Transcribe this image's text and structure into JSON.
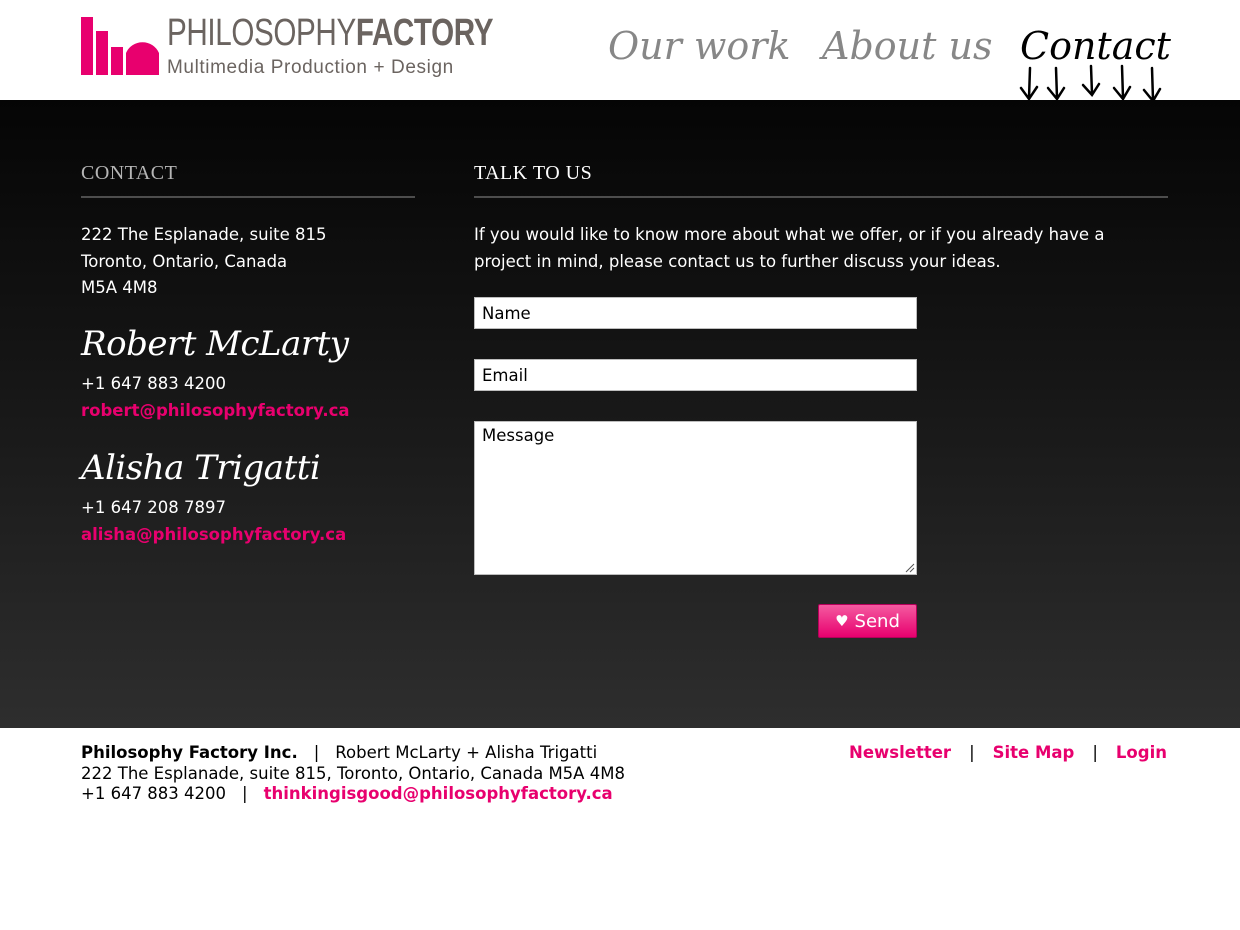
{
  "brand": {
    "name_thin": "PHILOSOPHY",
    "name_bold": "FACTORY",
    "tagline": "Multimedia Production + Design",
    "color": "#e8006e"
  },
  "nav": {
    "items": [
      {
        "label": "Our work"
      },
      {
        "label": "About us"
      },
      {
        "label": "Contact"
      }
    ]
  },
  "contact": {
    "heading": "CONTACT",
    "address": [
      "222 The Esplanade, suite 815",
      "Toronto, Ontario, Canada",
      "M5A 4M8"
    ],
    "people": [
      {
        "name": "Robert McLarty",
        "phone": "+1 647 883 4200",
        "email": "robert@philosophyfactory.ca"
      },
      {
        "name": "Alisha Trigatti",
        "phone": "+1 647 208 7897",
        "email": "alisha@philosophyfactory.ca"
      }
    ]
  },
  "talk": {
    "heading": "TALK TO US",
    "intro": "If you would like to know more about what we offer, or if you already have a project in mind, please contact us to further discuss your ideas.",
    "name_placeholder": "Name",
    "email_placeholder": "Email",
    "message_placeholder": "Message",
    "send_label": "Send"
  },
  "footer": {
    "company": "Philosophy Factory Inc.",
    "sep": "|",
    "people": "Robert McLarty + Alisha Trigatti",
    "address": "222 The Esplanade, suite 815, Toronto, Ontario, Canada M5A 4M8",
    "phone": "+1 647 883 4200",
    "email": "thinkingisgood@philosophyfactory.ca",
    "links": [
      {
        "label": "Newsletter"
      },
      {
        "label": "Site Map"
      },
      {
        "label": "Login"
      }
    ]
  }
}
